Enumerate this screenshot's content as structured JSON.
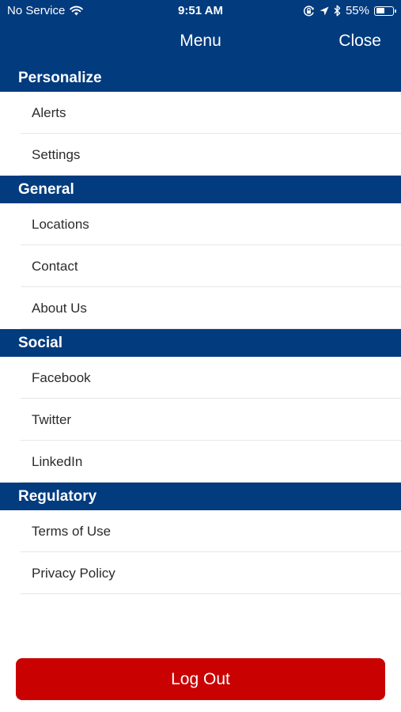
{
  "status_bar": {
    "carrier": "No Service",
    "time": "9:51 AM",
    "battery_percent": "55%",
    "battery_level": 0.55,
    "icons": [
      "wifi-icon",
      "orientation-lock-icon",
      "location-arrow-icon",
      "bluetooth-icon",
      "battery-icon"
    ]
  },
  "header": {
    "title": "Menu",
    "close_label": "Close"
  },
  "sections": [
    {
      "title": "Personalize",
      "items": [
        "Alerts",
        "Settings"
      ]
    },
    {
      "title": "General",
      "items": [
        "Locations",
        "Contact",
        "About Us"
      ]
    },
    {
      "title": "Social",
      "items": [
        "Facebook",
        "Twitter",
        "LinkedIn"
      ]
    },
    {
      "title": "Regulatory",
      "items": [
        "Terms of Use",
        "Privacy Policy"
      ]
    }
  ],
  "logout_label": "Log Out",
  "colors": {
    "primary": "#023b7e",
    "logout": "#c90101",
    "item_text": "#2b2b2b",
    "divider": "#e6e6e6"
  }
}
